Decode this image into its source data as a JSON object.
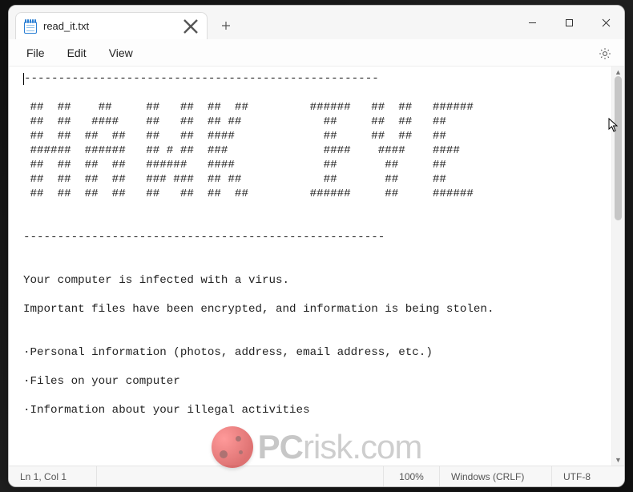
{
  "tab": {
    "title": "read_it.txt",
    "close_tooltip": "Close tab"
  },
  "menubar": {
    "file": "File",
    "edit": "Edit",
    "view": "View",
    "settings_tooltip": "Settings"
  },
  "content": {
    "line01": "----------------------------------------------------",
    "line02": "",
    "line03": " ##  ##    ##     ##   ##  ##  ##         ######   ##  ##   ######",
    "line04": " ##  ##   ####    ##   ##  ## ##            ##     ##  ##   ##",
    "line05": " ##  ##  ##  ##   ##   ##  ####             ##     ##  ##   ##",
    "line06": " ######  ######   ## # ##  ###              ####    ####    ####",
    "line07": " ##  ##  ##  ##   ######   ####             ##       ##     ##",
    "line08": " ##  ##  ##  ##   ### ###  ## ##            ##       ##     ##",
    "line09": " ##  ##  ##  ##   ##   ##  ##  ##         ######     ##     ######",
    "line10": "",
    "line11": "",
    "line12": "-----------------------------------------------------",
    "line13": "",
    "line14": "",
    "line15": "Your computer is infected with a virus.",
    "line16": "",
    "line17": "Important files have been encrypted, and information is being stolen.",
    "line18": "",
    "line19": "",
    "line20": "·Personal information (photos, address, email address, etc.)",
    "line21": "",
    "line22": "·Files on your computer",
    "line23": "",
    "line24": "·Information about your illegal activities"
  },
  "statusbar": {
    "position": "Ln 1, Col 1",
    "zoom": "100%",
    "line_endings": "Windows (CRLF)",
    "encoding": "UTF-8"
  },
  "watermark": {
    "brand_bold": "PC",
    "brand_rest": "risk.com"
  }
}
